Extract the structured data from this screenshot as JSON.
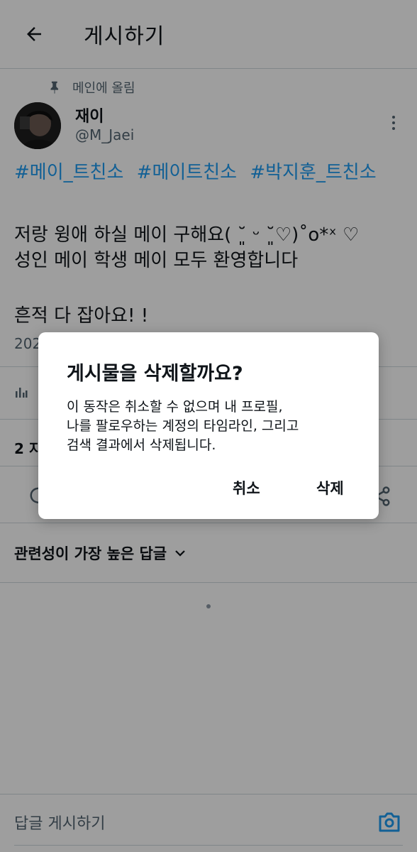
{
  "header": {
    "title": "게시하기"
  },
  "pinned": {
    "label": "메인에 올림"
  },
  "user": {
    "name": "재이",
    "handle": "@M_Jaei"
  },
  "post": {
    "hashtags": [
      "#메이_트친소",
      "#메이트친소",
      "#박지훈_트친소"
    ],
    "lines": [
      "저랑 윙애 하실 메이 구해요( ˘͈ ᵕ ˘͈♡)˚o*ˣ ♡",
      "성인 메이 학생 메이 모두 환영합니다",
      "흔적 다 잡아요! !"
    ],
    "date_partial": "202",
    "stats_partial": "2 지"
  },
  "replies": {
    "sort_label": "관련성이 가장 높은 답글"
  },
  "reply_bar": {
    "placeholder": "답글 게시하기"
  },
  "dialog": {
    "title": "게시물을 삭제할까요?",
    "message_lines": [
      "이 동작은 취소할 수 없으며 내 프로필,",
      "나를 팔로우하는 계정의 타임라인, 그리고",
      "검색 결과에서 삭제됩니다."
    ],
    "cancel_label": "취소",
    "delete_label": "삭제"
  },
  "colors": {
    "link": "#1d9bf0",
    "text": "#0f1419",
    "muted": "#536471",
    "scrim": "rgba(0,0,0,0.38)"
  },
  "icons": [
    "back-arrow-icon",
    "pin-icon",
    "more-vertical-icon",
    "views-icon",
    "reply-icon",
    "share-icon",
    "chevron-down-icon",
    "camera-icon"
  ]
}
